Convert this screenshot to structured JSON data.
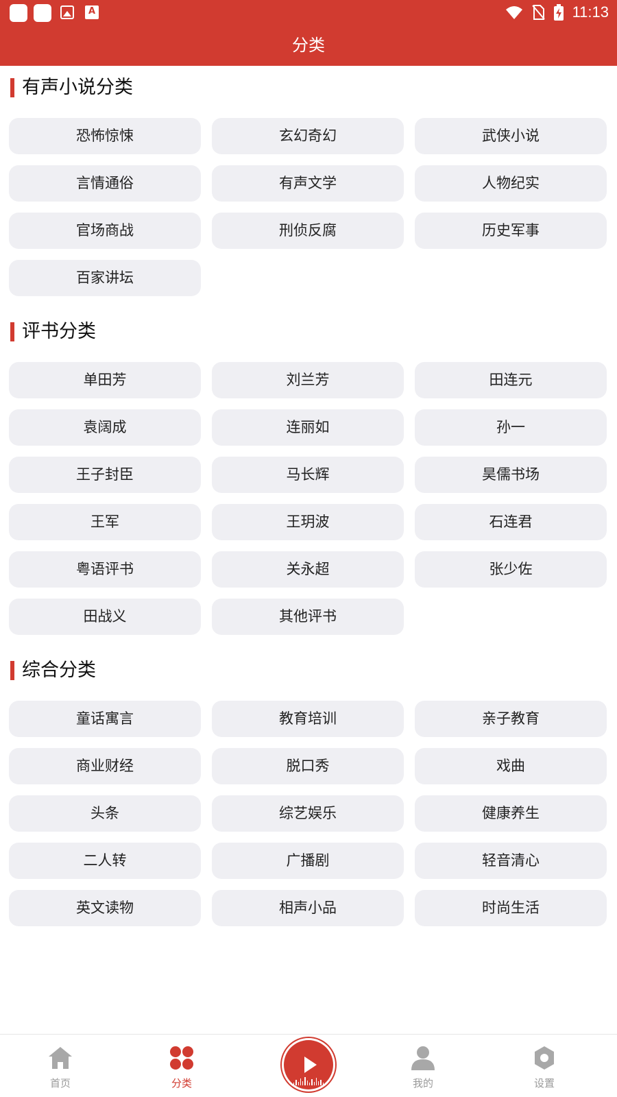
{
  "status_bar": {
    "time": "11:13"
  },
  "header": {
    "title": "分类"
  },
  "sections": [
    {
      "title": "有声小说分类",
      "items": [
        "恐怖惊悚",
        "玄幻奇幻",
        "武侠小说",
        "言情通俗",
        "有声文学",
        "人物纪实",
        "官场商战",
        "刑侦反腐",
        "历史军事",
        "百家讲坛"
      ]
    },
    {
      "title": "评书分类",
      "items": [
        "单田芳",
        "刘兰芳",
        "田连元",
        "袁阔成",
        "连丽如",
        "孙一",
        "王子封臣",
        "马长辉",
        "昊儒书场",
        "王军",
        "王玥波",
        "石连君",
        "粤语评书",
        "关永超",
        "张少佐",
        "田战义",
        "其他评书"
      ]
    },
    {
      "title": "综合分类",
      "items": [
        "童话寓言",
        "教育培训",
        "亲子教育",
        "商业财经",
        "脱口秀",
        "戏曲",
        "头条",
        "综艺娱乐",
        "健康养生",
        "二人转",
        "广播剧",
        "轻音清心",
        "英文读物",
        "相声小品",
        "时尚生活"
      ]
    }
  ],
  "bottom_nav": {
    "home": "首页",
    "category": "分类",
    "mine": "我的",
    "settings": "设置",
    "active_color": "#d13b30",
    "inactive_color": "#9a9a9a"
  },
  "colors": {
    "accent": "#d13b30",
    "chip_bg": "#efeff3"
  }
}
